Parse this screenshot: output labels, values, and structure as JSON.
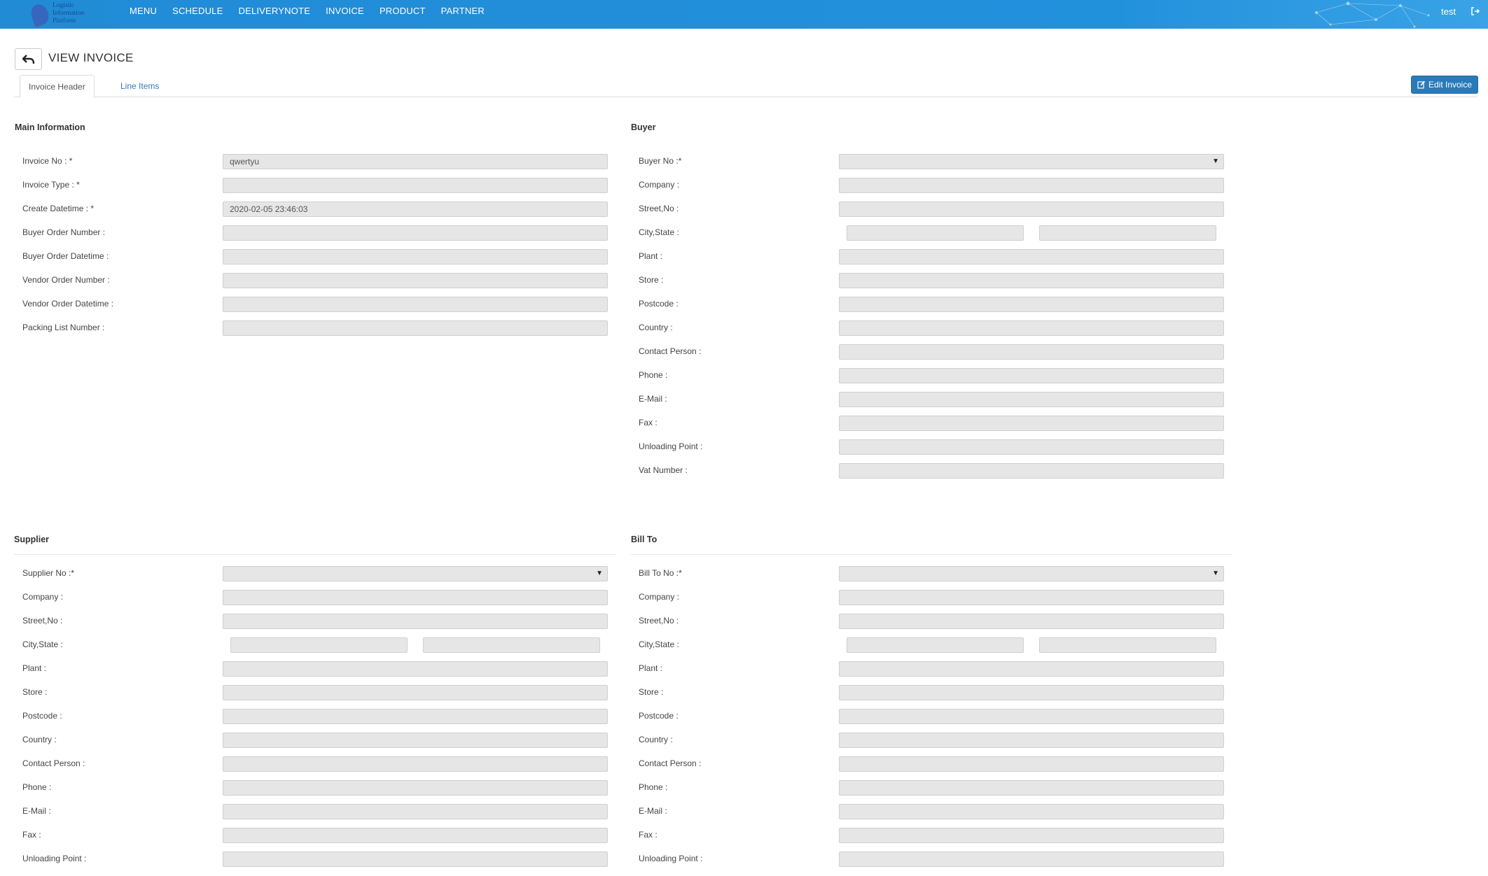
{
  "nav": {
    "logo_text": [
      "Logistic",
      "Information",
      "Platform"
    ],
    "menu": [
      "MENU",
      "SCHEDULE",
      "DELIVERYNOTE",
      "INVOICE",
      "PRODUCT",
      "PARTNER"
    ],
    "user": "test",
    "logout_icon": "logout-icon"
  },
  "header": {
    "title": "VIEW INVOICE",
    "back_icon": "undo-arrow-icon",
    "tabs": [
      "Invoice Header",
      "Line Items"
    ],
    "edit_button": "Edit Invoice",
    "edit_icon": "edit-icon"
  },
  "main_info": {
    "title": "Main Information",
    "fields": [
      {
        "label": "Invoice No : *",
        "value": "qwertyu"
      },
      {
        "label": "Invoice Type : *",
        "value": ""
      },
      {
        "label": "Create Datetime : *",
        "value": "2020-02-05 23:46:03"
      },
      {
        "label": "Buyer Order Number :",
        "value": ""
      },
      {
        "label": "Buyer Order Datetime :",
        "value": ""
      },
      {
        "label": "Vendor Order Number :",
        "value": ""
      },
      {
        "label": "Vendor Order Datetime :",
        "value": ""
      },
      {
        "label": "Packing List Number :",
        "value": ""
      }
    ]
  },
  "buyer": {
    "title": "Buyer",
    "fields": [
      {
        "label": "Buyer No :*",
        "value": "",
        "type": "select"
      },
      {
        "label": "Company :",
        "value": ""
      },
      {
        "label": "Street,No :",
        "value": ""
      },
      {
        "label": "City,State :",
        "value": "",
        "type": "split"
      },
      {
        "label": "Plant :",
        "value": ""
      },
      {
        "label": "Store :",
        "value": ""
      },
      {
        "label": "Postcode :",
        "value": ""
      },
      {
        "label": "Country :",
        "value": ""
      },
      {
        "label": "Contact Person :",
        "value": ""
      },
      {
        "label": "Phone :",
        "value": ""
      },
      {
        "label": "E-Mail :",
        "value": ""
      },
      {
        "label": "Fax :",
        "value": ""
      },
      {
        "label": "Unloading Point :",
        "value": ""
      },
      {
        "label": "Vat Number :",
        "value": ""
      }
    ]
  },
  "supplier": {
    "title": "Supplier",
    "fields": [
      {
        "label": "Supplier No :*",
        "value": "",
        "type": "select"
      },
      {
        "label": "Company :",
        "value": ""
      },
      {
        "label": "Street,No :",
        "value": ""
      },
      {
        "label": "City,State :",
        "value": "",
        "type": "split"
      },
      {
        "label": "Plant :",
        "value": ""
      },
      {
        "label": "Store :",
        "value": ""
      },
      {
        "label": "Postcode :",
        "value": ""
      },
      {
        "label": "Country :",
        "value": ""
      },
      {
        "label": "Contact Person :",
        "value": ""
      },
      {
        "label": "Phone :",
        "value": ""
      },
      {
        "label": "E-Mail :",
        "value": ""
      },
      {
        "label": "Fax :",
        "value": ""
      },
      {
        "label": "Unloading Point :",
        "value": ""
      }
    ]
  },
  "bill_to": {
    "title": "Bill To",
    "fields": [
      {
        "label": "Bill To No :*",
        "value": "",
        "type": "select"
      },
      {
        "label": "Company :",
        "value": ""
      },
      {
        "label": "Street,No :",
        "value": ""
      },
      {
        "label": "City,State :",
        "value": "",
        "type": "split"
      },
      {
        "label": "Plant :",
        "value": ""
      },
      {
        "label": "Store :",
        "value": ""
      },
      {
        "label": "Postcode :",
        "value": ""
      },
      {
        "label": "Country :",
        "value": ""
      },
      {
        "label": "Contact Person :",
        "value": ""
      },
      {
        "label": "Phone :",
        "value": ""
      },
      {
        "label": "E-Mail :",
        "value": ""
      },
      {
        "label": "Fax :",
        "value": ""
      },
      {
        "label": "Unloading Point :",
        "value": ""
      }
    ]
  },
  "colors": {
    "navbar": "#218bd6",
    "primary_button": "#2a7ab9",
    "field_bg": "#e6e6e6",
    "link": "#337ab7"
  }
}
